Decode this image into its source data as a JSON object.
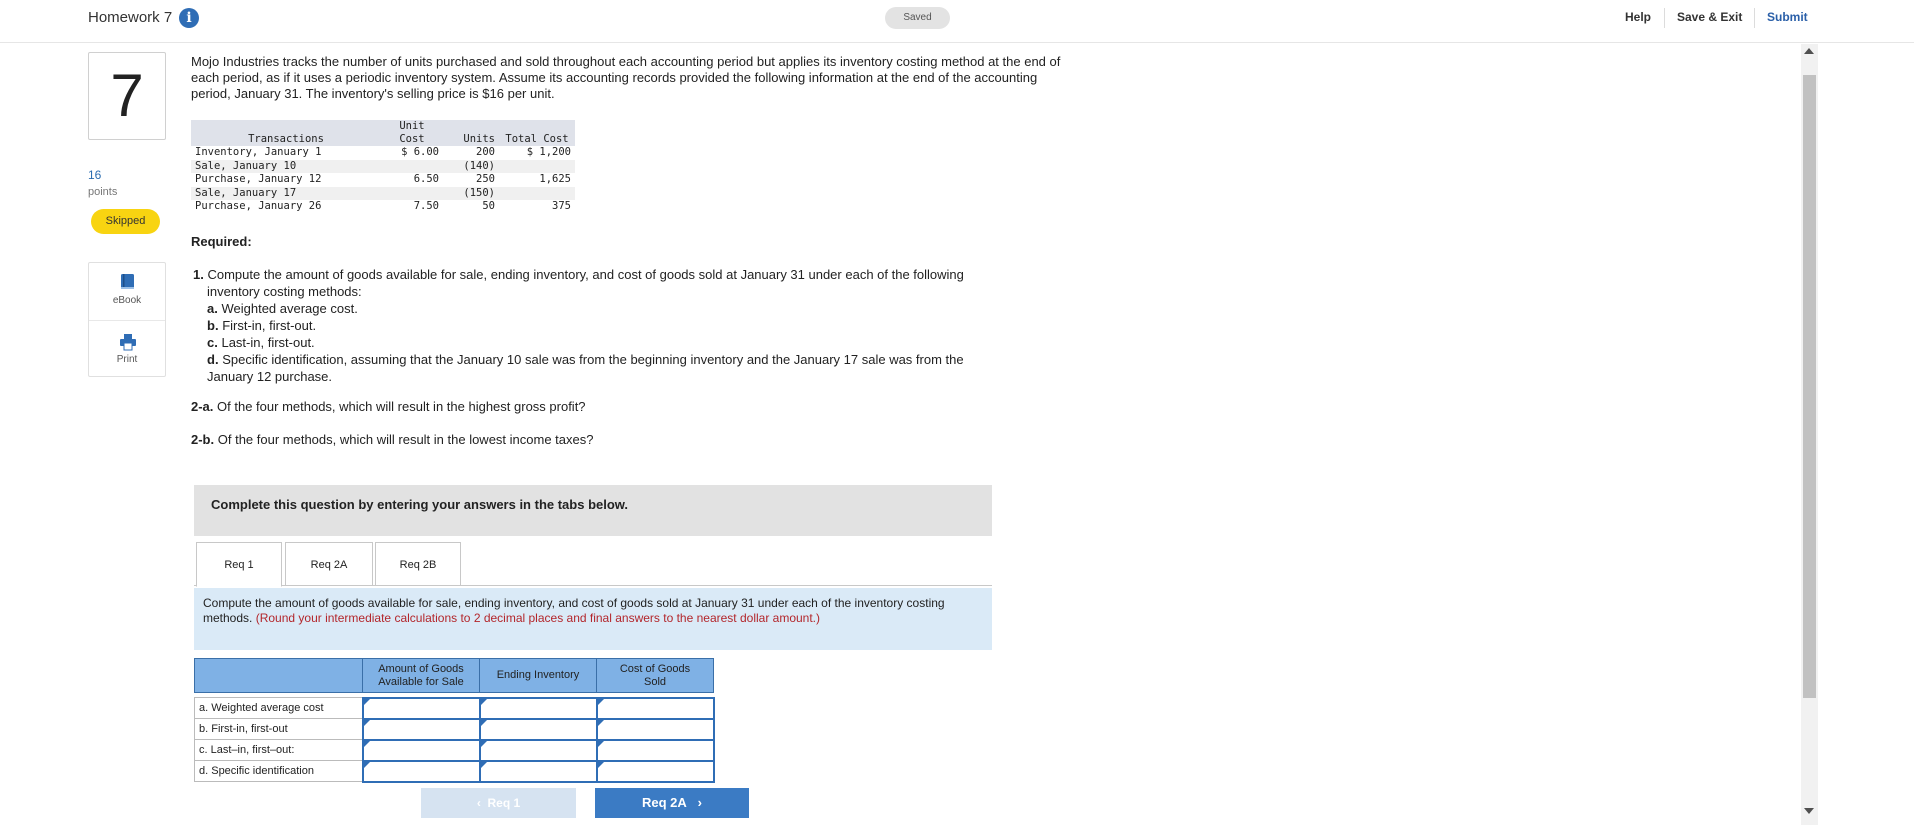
{
  "header": {
    "title": "Homework 7",
    "info_glyph": "i",
    "saved": "Saved",
    "help": "Help",
    "save_exit": "Save & Exit",
    "submit": "Submit"
  },
  "sidebar": {
    "question_number": "7",
    "points_value": "16",
    "points_label": "points",
    "status": "Skipped",
    "ebook_label": "eBook",
    "print_label": "Print"
  },
  "problem": {
    "intro": "Mojo Industries tracks the number of units purchased and sold throughout each accounting period but applies its inventory costing method at the end of each period, as if it uses a periodic inventory system. Assume its accounting records provided the following information at the end of the accounting period, January 31. The inventory's selling price is $16 per unit."
  },
  "transactions": {
    "headers": {
      "transactions": "Transactions",
      "unit_cost_line1": "Unit",
      "unit_cost_line2": "Cost",
      "units": "Units",
      "total_cost": "Total Cost"
    },
    "rows": [
      {
        "name": "Inventory, January 1",
        "unit_cost": "$ 6.00",
        "units": "200",
        "total": "$ 1,200"
      },
      {
        "name": "Sale, January 10",
        "unit_cost": "",
        "units": "(140)",
        "total": ""
      },
      {
        "name": "Purchase, January 12",
        "unit_cost": "6.50",
        "units": "250",
        "total": "1,625"
      },
      {
        "name": "Sale, January 17",
        "unit_cost": "",
        "units": "(150)",
        "total": ""
      },
      {
        "name": "Purchase, January 26",
        "unit_cost": "7.50",
        "units": "50",
        "total": "375"
      }
    ]
  },
  "required": {
    "heading": "Required:",
    "q1_num": "1.",
    "q1_text": "Compute the amount of goods available for sale, ending inventory, and cost of goods sold at January 31 under each of the following",
    "q1_text2": "inventory costing methods:",
    "a_label": "a.",
    "a_text": "Weighted average cost.",
    "b_label": "b.",
    "b_text": "First-in, first-out.",
    "c_label": "c.",
    "c_text": "Last-in, first-out.",
    "d_label": "d.",
    "d_text": "Specific identification, assuming that the January 10 sale was from the beginning inventory and the January 17 sale was from the",
    "d_text2": "January 12 purchase.",
    "q2a_label": "2-a.",
    "q2a_text": "Of the four methods, which will result in the highest gross profit?",
    "q2b_label": "2-b.",
    "q2b_text": "Of the four methods, which will result in the lowest income taxes?"
  },
  "panel": {
    "instruction": "Complete this question by entering your answers in the tabs below.",
    "tabs": [
      "Req 1",
      "Req 2A",
      "Req 2B"
    ],
    "tab_instruction": "Compute the amount of goods available for sale, ending inventory, and cost of goods sold at January 31 under each of the inventory costing methods.",
    "tab_note": "(Round your intermediate calculations to 2 decimal places and final answers to the nearest dollar amount.)"
  },
  "answer_table": {
    "col_available_line1": "Amount of Goods",
    "col_available_line2": "Available for Sale",
    "col_ending": "Ending Inventory",
    "col_cogs_line1": "Cost of Goods",
    "col_cogs_line2": "Sold",
    "rows": [
      "a. Weighted average cost",
      "b. First-in, first-out",
      "c. Last–in, first–out:",
      "d. Specific identification"
    ]
  },
  "nav": {
    "prev": "Req 1",
    "next": "Req 2A",
    "prev_glyph": "‹",
    "next_glyph": "›"
  },
  "icons": {
    "info": "info-icon",
    "ebook": "book-icon",
    "print": "printer-icon",
    "scroll_up": "arrow-up-icon",
    "scroll_down": "arrow-down-icon"
  },
  "colors": {
    "accent_blue": "#2f6db5",
    "skipped_yellow": "#f8d411",
    "table_header_blue": "#7fb1e5",
    "next_button": "#3b7bc4",
    "note_red": "#b3262b"
  }
}
